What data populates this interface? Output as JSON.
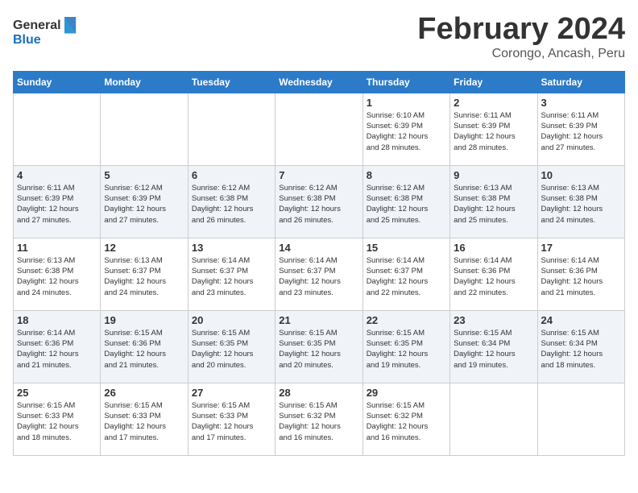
{
  "header": {
    "logo_general": "General",
    "logo_blue": "Blue",
    "title": "February 2024",
    "subtitle": "Corongo, Ancash, Peru"
  },
  "days_of_week": [
    "Sunday",
    "Monday",
    "Tuesday",
    "Wednesday",
    "Thursday",
    "Friday",
    "Saturday"
  ],
  "weeks": [
    [
      {
        "day": "",
        "info": ""
      },
      {
        "day": "",
        "info": ""
      },
      {
        "day": "",
        "info": ""
      },
      {
        "day": "",
        "info": ""
      },
      {
        "day": "1",
        "info": "Sunrise: 6:10 AM\nSunset: 6:39 PM\nDaylight: 12 hours\nand 28 minutes."
      },
      {
        "day": "2",
        "info": "Sunrise: 6:11 AM\nSunset: 6:39 PM\nDaylight: 12 hours\nand 28 minutes."
      },
      {
        "day": "3",
        "info": "Sunrise: 6:11 AM\nSunset: 6:39 PM\nDaylight: 12 hours\nand 27 minutes."
      }
    ],
    [
      {
        "day": "4",
        "info": "Sunrise: 6:11 AM\nSunset: 6:39 PM\nDaylight: 12 hours\nand 27 minutes."
      },
      {
        "day": "5",
        "info": "Sunrise: 6:12 AM\nSunset: 6:39 PM\nDaylight: 12 hours\nand 27 minutes."
      },
      {
        "day": "6",
        "info": "Sunrise: 6:12 AM\nSunset: 6:38 PM\nDaylight: 12 hours\nand 26 minutes."
      },
      {
        "day": "7",
        "info": "Sunrise: 6:12 AM\nSunset: 6:38 PM\nDaylight: 12 hours\nand 26 minutes."
      },
      {
        "day": "8",
        "info": "Sunrise: 6:12 AM\nSunset: 6:38 PM\nDaylight: 12 hours\nand 25 minutes."
      },
      {
        "day": "9",
        "info": "Sunrise: 6:13 AM\nSunset: 6:38 PM\nDaylight: 12 hours\nand 25 minutes."
      },
      {
        "day": "10",
        "info": "Sunrise: 6:13 AM\nSunset: 6:38 PM\nDaylight: 12 hours\nand 24 minutes."
      }
    ],
    [
      {
        "day": "11",
        "info": "Sunrise: 6:13 AM\nSunset: 6:38 PM\nDaylight: 12 hours\nand 24 minutes."
      },
      {
        "day": "12",
        "info": "Sunrise: 6:13 AM\nSunset: 6:37 PM\nDaylight: 12 hours\nand 24 minutes."
      },
      {
        "day": "13",
        "info": "Sunrise: 6:14 AM\nSunset: 6:37 PM\nDaylight: 12 hours\nand 23 minutes."
      },
      {
        "day": "14",
        "info": "Sunrise: 6:14 AM\nSunset: 6:37 PM\nDaylight: 12 hours\nand 23 minutes."
      },
      {
        "day": "15",
        "info": "Sunrise: 6:14 AM\nSunset: 6:37 PM\nDaylight: 12 hours\nand 22 minutes."
      },
      {
        "day": "16",
        "info": "Sunrise: 6:14 AM\nSunset: 6:36 PM\nDaylight: 12 hours\nand 22 minutes."
      },
      {
        "day": "17",
        "info": "Sunrise: 6:14 AM\nSunset: 6:36 PM\nDaylight: 12 hours\nand 21 minutes."
      }
    ],
    [
      {
        "day": "18",
        "info": "Sunrise: 6:14 AM\nSunset: 6:36 PM\nDaylight: 12 hours\nand 21 minutes."
      },
      {
        "day": "19",
        "info": "Sunrise: 6:15 AM\nSunset: 6:36 PM\nDaylight: 12 hours\nand 21 minutes."
      },
      {
        "day": "20",
        "info": "Sunrise: 6:15 AM\nSunset: 6:35 PM\nDaylight: 12 hours\nand 20 minutes."
      },
      {
        "day": "21",
        "info": "Sunrise: 6:15 AM\nSunset: 6:35 PM\nDaylight: 12 hours\nand 20 minutes."
      },
      {
        "day": "22",
        "info": "Sunrise: 6:15 AM\nSunset: 6:35 PM\nDaylight: 12 hours\nand 19 minutes."
      },
      {
        "day": "23",
        "info": "Sunrise: 6:15 AM\nSunset: 6:34 PM\nDaylight: 12 hours\nand 19 minutes."
      },
      {
        "day": "24",
        "info": "Sunrise: 6:15 AM\nSunset: 6:34 PM\nDaylight: 12 hours\nand 18 minutes."
      }
    ],
    [
      {
        "day": "25",
        "info": "Sunrise: 6:15 AM\nSunset: 6:33 PM\nDaylight: 12 hours\nand 18 minutes."
      },
      {
        "day": "26",
        "info": "Sunrise: 6:15 AM\nSunset: 6:33 PM\nDaylight: 12 hours\nand 17 minutes."
      },
      {
        "day": "27",
        "info": "Sunrise: 6:15 AM\nSunset: 6:33 PM\nDaylight: 12 hours\nand 17 minutes."
      },
      {
        "day": "28",
        "info": "Sunrise: 6:15 AM\nSunset: 6:32 PM\nDaylight: 12 hours\nand 16 minutes."
      },
      {
        "day": "29",
        "info": "Sunrise: 6:15 AM\nSunset: 6:32 PM\nDaylight: 12 hours\nand 16 minutes."
      },
      {
        "day": "",
        "info": ""
      },
      {
        "day": "",
        "info": ""
      }
    ]
  ]
}
